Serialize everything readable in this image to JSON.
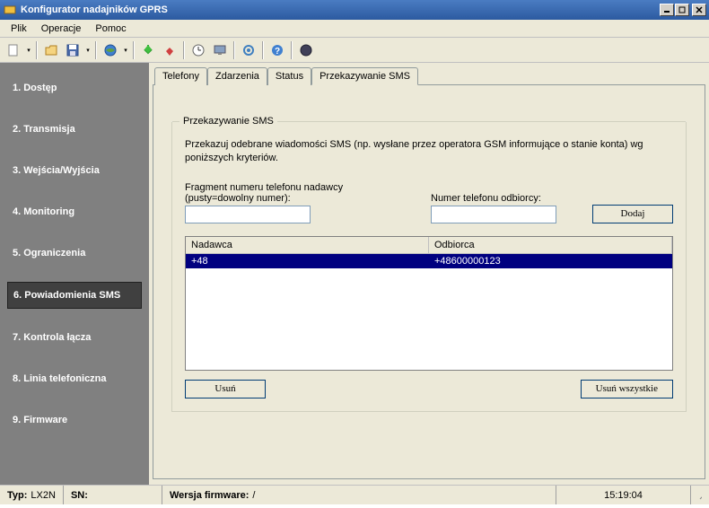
{
  "window": {
    "title": "Konfigurator nadajników GPRS"
  },
  "menu": {
    "file": "Plik",
    "operations": "Operacje",
    "help": "Pomoc"
  },
  "sidebar": {
    "items": [
      {
        "label": "1. Dostęp"
      },
      {
        "label": "2. Transmisja"
      },
      {
        "label": "3. Wejścia/Wyjścia"
      },
      {
        "label": "4. Monitoring"
      },
      {
        "label": "5. Ograniczenia"
      },
      {
        "label": "6. Powiadomienia SMS"
      },
      {
        "label": "7. Kontrola łącza"
      },
      {
        "label": "8. Linia telefoniczna"
      },
      {
        "label": "9. Firmware"
      }
    ],
    "active_index": 5
  },
  "tabs": {
    "items": [
      {
        "label": "Telefony"
      },
      {
        "label": "Zdarzenia"
      },
      {
        "label": "Status"
      },
      {
        "label": "Przekazywanie SMS"
      }
    ],
    "active_index": 3
  },
  "panel": {
    "legend": "Przekazywanie SMS",
    "description": "Przekazuj odebrane wiadomości SMS (np. wysłane przez operatora GSM informujące o stanie konta) wg poniższych kryteriów.",
    "sender_label": "Fragment numeru telefonu nadawcy (pusty=dowolny numer):",
    "recipient_label": "Numer telefonu odbiorcy:",
    "sender_value": "",
    "recipient_value": "",
    "add_button": "Dodaj",
    "columns": {
      "sender": "Nadawca",
      "recipient": "Odbiorca"
    },
    "rows": [
      {
        "sender": "+48",
        "recipient": "+48600000123"
      }
    ],
    "delete_button": "Usuń",
    "delete_all_button": "Usuń wszystkie"
  },
  "status": {
    "type_label": "Typ:",
    "type_value": "LX2N",
    "sn_label": "SN:",
    "sn_value": "",
    "firmware_label": "Wersja firmware:",
    "firmware_value": "/",
    "time": "15:19:04"
  }
}
